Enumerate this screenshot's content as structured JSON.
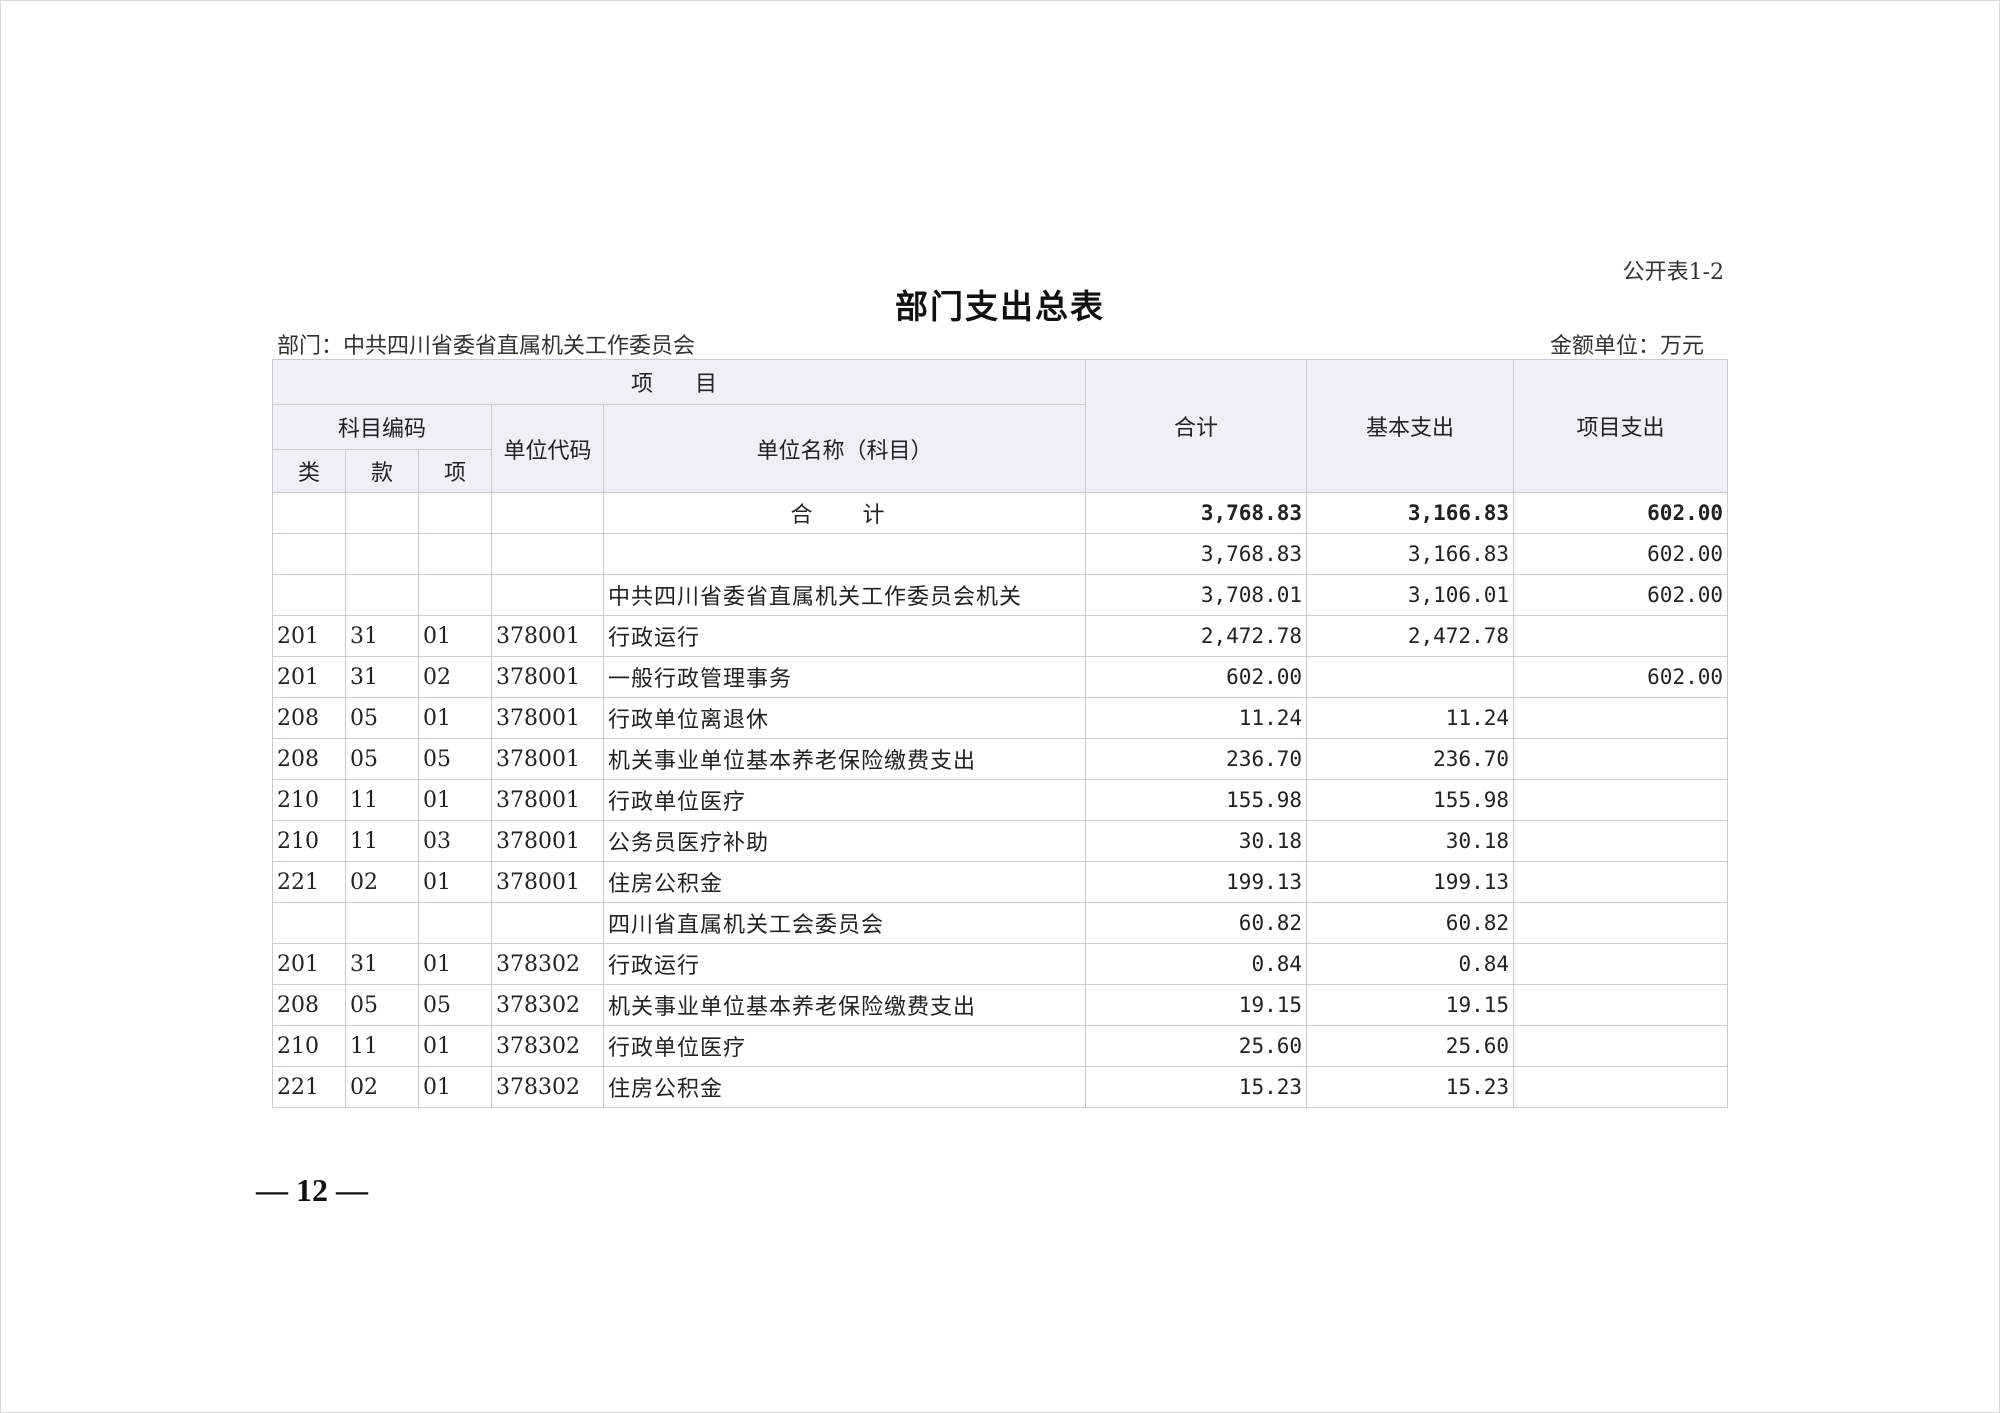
{
  "table_number": "公开表1-2",
  "title": "部门支出总表",
  "department_label": "部门：中共四川省委省直属机关工作委员会",
  "unit_label": "金额单位：万元",
  "headers": {
    "project": "项　目",
    "subject_code": "科目编码",
    "unit_code": "单位代码",
    "unit_name": "单位名称（科目）",
    "total": "合计",
    "basic": "基本支出",
    "project_exp": "项目支出",
    "lei": "类",
    "kuan": "款",
    "xiang": "项"
  },
  "rows": [
    {
      "lei": "",
      "kuan": "",
      "xiang": "",
      "code": "",
      "name": "合　计",
      "total": "3,768.83",
      "basic": "3,166.83",
      "project": "602.00",
      "is_total": true
    },
    {
      "lei": "",
      "kuan": "",
      "xiang": "",
      "code": "",
      "name": "",
      "total": "3,768.83",
      "basic": "3,166.83",
      "project": "602.00"
    },
    {
      "lei": "",
      "kuan": "",
      "xiang": "",
      "code": "",
      "name": "中共四川省委省直属机关工作委员会机关",
      "total": "3,708.01",
      "basic": "3,106.01",
      "project": "602.00"
    },
    {
      "lei": "201",
      "kuan": "31",
      "xiang": "01",
      "code": "378001",
      "name": "行政运行",
      "total": "2,472.78",
      "basic": "2,472.78",
      "project": ""
    },
    {
      "lei": "201",
      "kuan": "31",
      "xiang": "02",
      "code": "378001",
      "name": "一般行政管理事务",
      "total": "602.00",
      "basic": "",
      "project": "602.00"
    },
    {
      "lei": "208",
      "kuan": "05",
      "xiang": "01",
      "code": "378001",
      "name": "行政单位离退休",
      "total": "11.24",
      "basic": "11.24",
      "project": ""
    },
    {
      "lei": "208",
      "kuan": "05",
      "xiang": "05",
      "code": "378001",
      "name": "机关事业单位基本养老保险缴费支出",
      "total": "236.70",
      "basic": "236.70",
      "project": ""
    },
    {
      "lei": "210",
      "kuan": "11",
      "xiang": "01",
      "code": "378001",
      "name": "行政单位医疗",
      "total": "155.98",
      "basic": "155.98",
      "project": ""
    },
    {
      "lei": "210",
      "kuan": "11",
      "xiang": "03",
      "code": "378001",
      "name": "公务员医疗补助",
      "total": "30.18",
      "basic": "30.18",
      "project": ""
    },
    {
      "lei": "221",
      "kuan": "02",
      "xiang": "01",
      "code": "378001",
      "name": "住房公积金",
      "total": "199.13",
      "basic": "199.13",
      "project": ""
    },
    {
      "lei": "",
      "kuan": "",
      "xiang": "",
      "code": "",
      "name": "四川省直属机关工会委员会",
      "total": "60.82",
      "basic": "60.82",
      "project": ""
    },
    {
      "lei": "201",
      "kuan": "31",
      "xiang": "01",
      "code": "378302",
      "name": "行政运行",
      "total": "0.84",
      "basic": "0.84",
      "project": ""
    },
    {
      "lei": "208",
      "kuan": "05",
      "xiang": "05",
      "code": "378302",
      "name": "机关事业单位基本养老保险缴费支出",
      "total": "19.15",
      "basic": "19.15",
      "project": ""
    },
    {
      "lei": "210",
      "kuan": "11",
      "xiang": "01",
      "code": "378302",
      "name": "行政单位医疗",
      "total": "25.60",
      "basic": "25.60",
      "project": ""
    },
    {
      "lei": "221",
      "kuan": "02",
      "xiang": "01",
      "code": "378302",
      "name": "住房公积金",
      "total": "15.23",
      "basic": "15.23",
      "project": ""
    }
  ],
  "page_number": "— 12 —"
}
